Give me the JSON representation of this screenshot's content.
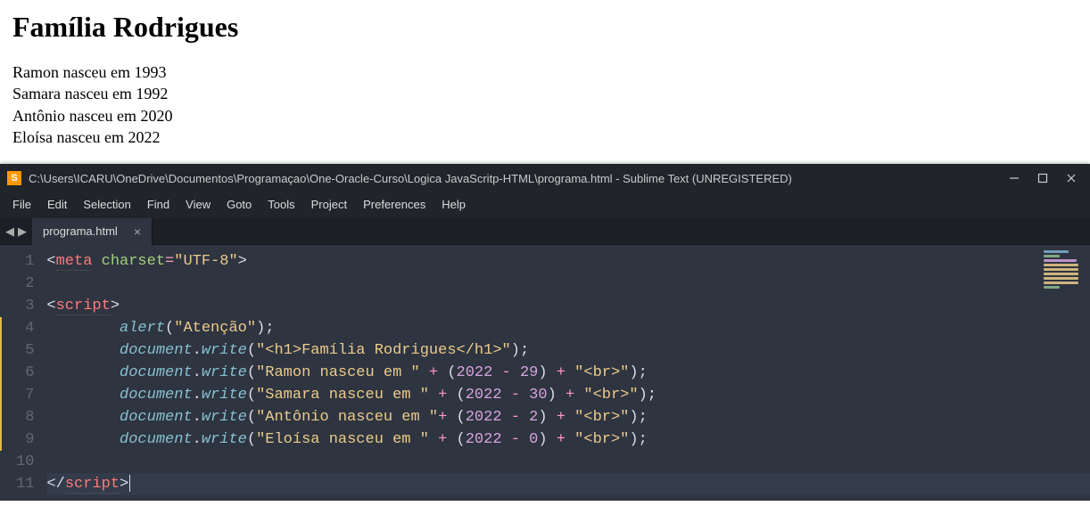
{
  "browser": {
    "heading": "Família Rodrigues",
    "lines": [
      "Ramon nasceu em 1993",
      "Samara nasceu em 1992",
      "Antônio nasceu em 2020",
      "Eloísa nasceu em 2022"
    ]
  },
  "editor": {
    "app_icon_letter": "S",
    "title": "C:\\Users\\ICARU\\OneDrive\\Documentos\\Programaçao\\One-Oracle-Curso\\Logica JavaScritp-HTML\\programa.html - Sublime Text (UNREGISTERED)",
    "menu": [
      "File",
      "Edit",
      "Selection",
      "Find",
      "View",
      "Goto",
      "Tools",
      "Project",
      "Preferences",
      "Help"
    ],
    "tab": {
      "label": "programa.html",
      "close": "×"
    },
    "nav_left": "◀",
    "nav_right": "▶",
    "code_tokens": {
      "meta": "meta",
      "charset": "charset",
      "utf8": "\"UTF-8\"",
      "script": "script",
      "alert": "alert",
      "document": "document",
      "write": "write",
      "atencao": "\"Atenção\"",
      "h1str": "\"<h1>Família Rodrigues</h1>\"",
      "ramon": "\"Ramon nasceu em \"",
      "samara": "\"Samara nasceu em \"",
      "antonio": "\"Antônio nasceu em \"",
      "eloisa": "\"Eloísa nasceu em \"",
      "br": "\"<br>\"",
      "y2022": "2022",
      "n29": "29",
      "n30": "30",
      "n2": "2",
      "n0": "0"
    },
    "line_numbers": [
      "1",
      "2",
      "3",
      "4",
      "5",
      "6",
      "7",
      "8",
      "9",
      "10",
      "11"
    ]
  }
}
